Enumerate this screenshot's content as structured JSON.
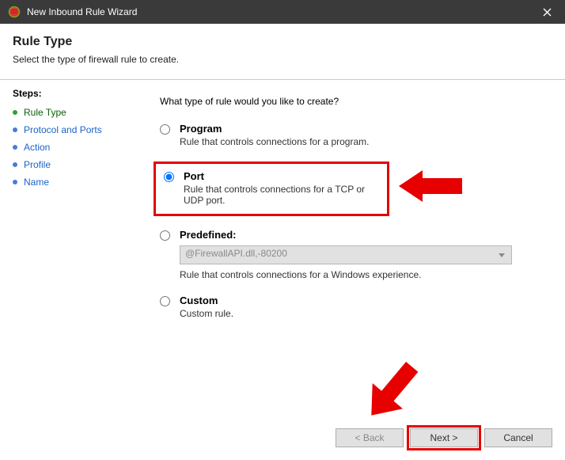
{
  "window": {
    "title": "New Inbound Rule Wizard"
  },
  "header": {
    "title": "Rule Type",
    "subtitle": "Select the type of firewall rule to create."
  },
  "steps": {
    "label": "Steps:",
    "items": [
      {
        "label": "Rule Type",
        "state": "current"
      },
      {
        "label": "Protocol and Ports",
        "state": "link"
      },
      {
        "label": "Action",
        "state": "pending"
      },
      {
        "label": "Profile",
        "state": "pending"
      },
      {
        "label": "Name",
        "state": "pending"
      }
    ]
  },
  "content": {
    "question": "What type of rule would you like to create?",
    "options": {
      "program": {
        "label": "Program",
        "desc": "Rule that controls connections for a program.",
        "selected": false
      },
      "port": {
        "label": "Port",
        "desc": "Rule that controls connections for a TCP or UDP port.",
        "selected": true
      },
      "predefined": {
        "label": "Predefined:",
        "combo_value": "@FirewallAPI.dll,-80200",
        "desc": "Rule that controls connections for a Windows experience.",
        "selected": false
      },
      "custom": {
        "label": "Custom",
        "desc": "Custom rule.",
        "selected": false
      }
    }
  },
  "footer": {
    "back": "< Back",
    "next": "Next >",
    "cancel": "Cancel"
  }
}
